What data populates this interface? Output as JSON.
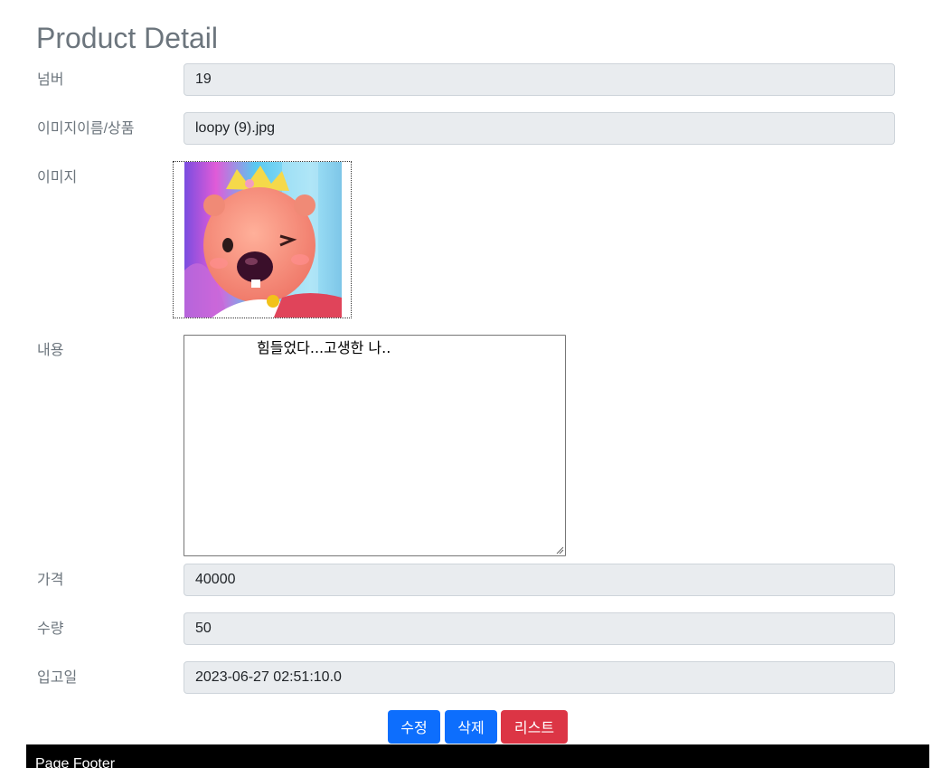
{
  "page": {
    "title": "Product Detail"
  },
  "fields": {
    "number": {
      "label": "넘버",
      "value": "19"
    },
    "image_name": {
      "label": "이미지이름/상품",
      "value": "loopy (9).jpg"
    },
    "image": {
      "label": "이미지",
      "depicts": "pink cartoon beaver character with tiara, winking"
    },
    "content": {
      "label": "내용",
      "value": "힘들었다...고생한 나.."
    },
    "price": {
      "label": "가격",
      "value": "40000"
    },
    "quantity": {
      "label": "수량",
      "value": "50"
    },
    "date": {
      "label": "입고일",
      "value": "2023-06-27 02:51:10.0"
    }
  },
  "buttons": {
    "edit": "수정",
    "delete": "삭제",
    "list": "리스트"
  },
  "colors": {
    "primary": "#0d6efd",
    "danger": "#dc3545",
    "field_bg": "#e9ecef",
    "label": "#6c757d"
  },
  "footer": {
    "text": "Page Footer"
  }
}
